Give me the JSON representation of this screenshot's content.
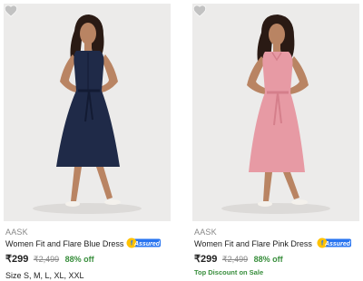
{
  "colors": {
    "accent_green": "#388e3c",
    "assured_blue": "#2874f0",
    "dress_blue": "#1f2a48",
    "dress_pink": "#e79aa4",
    "photo_bg": "#ecebea"
  },
  "products": [
    {
      "brand": "AASK",
      "title": "Women Fit and Flare Blue Dress",
      "price": "₹299",
      "mrp": "₹2,499",
      "discount": "88% off",
      "assured_label": "Assured",
      "sizes": "Size S, M, L, XL, XXL",
      "wishlist_icon": "heart-icon"
    },
    {
      "brand": "AASK",
      "title": "Women Fit and Flare Pink Dress",
      "price": "₹299",
      "mrp": "₹2,499",
      "discount": "88% off",
      "assured_label": "Assured",
      "promo": "Top Discount on Sale",
      "wishlist_icon": "heart-icon"
    }
  ]
}
